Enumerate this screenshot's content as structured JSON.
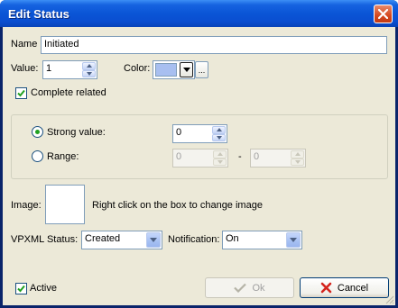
{
  "window": {
    "title": "Edit Status"
  },
  "form": {
    "name_label": "Name",
    "name_value": "Initiated",
    "value_label": "Value:",
    "value_value": "1",
    "color_label": "Color:",
    "color_swatch": "#a8bff0",
    "color_ellipsis": "...",
    "complete_related_label": "Complete related",
    "complete_related_checked": true
  },
  "value_group": {
    "strong_label": "Strong value:",
    "strong_value": "0",
    "range_label": "Range:",
    "range_from": "0",
    "range_sep": "-",
    "range_to": "0"
  },
  "image": {
    "label": "Image:",
    "hint": "Right click on the box to  change image"
  },
  "vpxml": {
    "status_label": "VPXML Status:",
    "status_value": "Created",
    "notification_label": "Notification:",
    "notification_value": "On"
  },
  "footer": {
    "active_label": "Active",
    "active_checked": true,
    "ok_label": "Ok",
    "cancel_label": "Cancel"
  },
  "colors": {
    "title_bar": "#0a55d6",
    "dialog_bg": "#ece9d8",
    "accent_border": "#7f9db9",
    "cancel_x": "#d4241c",
    "check_green": "#21a121"
  }
}
